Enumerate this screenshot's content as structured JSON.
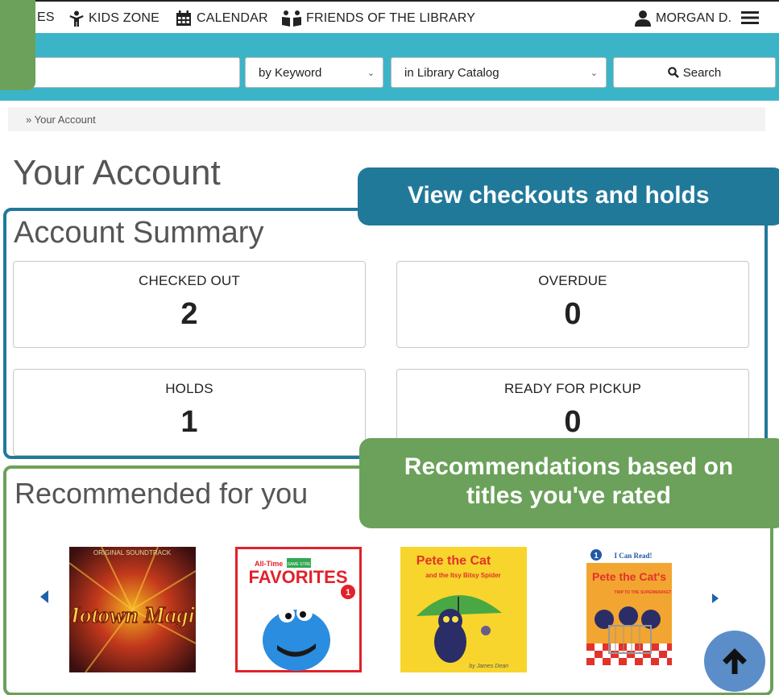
{
  "nav": {
    "partial_item": "ES",
    "kids_zone": "KIDS ZONE",
    "calendar": "CALENDAR",
    "friends": "FRIENDS OF THE LIBRARY",
    "user": "MORGAN D."
  },
  "search": {
    "type_select": "by Keyword",
    "scope_select": "in Library Catalog",
    "button_label": "Search"
  },
  "breadcrumb": "» Your Account",
  "page_title": "Your Account",
  "summary": {
    "title": "Account Summary",
    "stats": [
      {
        "label": "CHECKED OUT",
        "value": "2"
      },
      {
        "label": "OVERDUE",
        "value": "0"
      },
      {
        "label": "HOLDS",
        "value": "1"
      },
      {
        "label": "READY FOR PICKUP",
        "value": "0"
      }
    ]
  },
  "callouts": {
    "checkouts": "View checkouts and holds",
    "recommendations_line1": "Recommendations based on",
    "recommendations_line2": "titles you've rated"
  },
  "recommended": {
    "title": "Recommended for you",
    "covers": [
      {
        "title": "Motown Magic",
        "banner": "ORIGINAL SOUNDTRACK"
      },
      {
        "title": "FAVORITES",
        "top": "All-Time",
        "badge": "SESAME STREET",
        "number": "1"
      },
      {
        "title": "Pete the Cat",
        "subtitle": "and the Itsy Bitsy Spider",
        "author": "by James Dean"
      },
      {
        "title": "Pete the Cat's",
        "subtitle": "TRIP TO THE SUPERMARKET",
        "series": "I Can Read!",
        "level": "1"
      }
    ]
  },
  "colors": {
    "teal_bar": "#3cb4c8",
    "callout_blue": "#21799a",
    "callout_green": "#6ba15a",
    "to_top": "#5b8ec8"
  }
}
